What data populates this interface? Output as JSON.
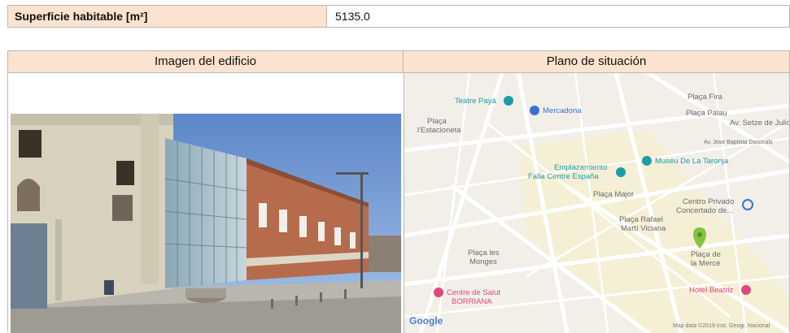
{
  "summary": {
    "label": "Superficie habitable [m²]",
    "value": "5135.0"
  },
  "table": {
    "col1_header": "Imagen del edificio",
    "col2_header": "Plano de situación"
  },
  "map": {
    "labels": {
      "teatre": "Teatre Payà",
      "mercadona": "Mercadona",
      "placa_fira": "Plaça Fira",
      "placa_palau": "Plaça Palau",
      "av_setze": "Av. Setze de Juliol",
      "placa_estacioneta_1": "Plaça",
      "placa_estacioneta_2": "l'Estacioneta",
      "av_jose_baptista": "Av. Jose Baptista Dasonals",
      "museu": "Museu De La Taronja",
      "emplazamiento_1": "Emplazamiento",
      "emplazamiento_2": "Falla Centre España",
      "placa_major": "Plaça Major",
      "centro_privado_1": "Centro Privado",
      "centro_privado_2": "Concertado de...",
      "placa_rafael_1": "Plaça Rafael",
      "placa_rafael_2": "Martí Viciana",
      "placa_monges_1": "Plaça les",
      "placa_monges_2": "Monges",
      "placa_merce_1": "Plaça de",
      "placa_merce_2": "la Mercè",
      "centre_salut_1": "Centre de Salut",
      "centre_salut_2": "BORRIANA",
      "hotel": "Hotel Beatriz",
      "google": "Google",
      "attribution": "Map data ©2019 Inst. Geogr. Nacional"
    }
  },
  "colors": {
    "header_bg": "#fbe3cf",
    "border": "#b9b9b9",
    "map_bg": "#f1efe8",
    "map_teal": "#1f9aa6",
    "map_blue": "#3b6fd8",
    "map_pink": "#e0487d",
    "marker_green": "#86c440"
  }
}
